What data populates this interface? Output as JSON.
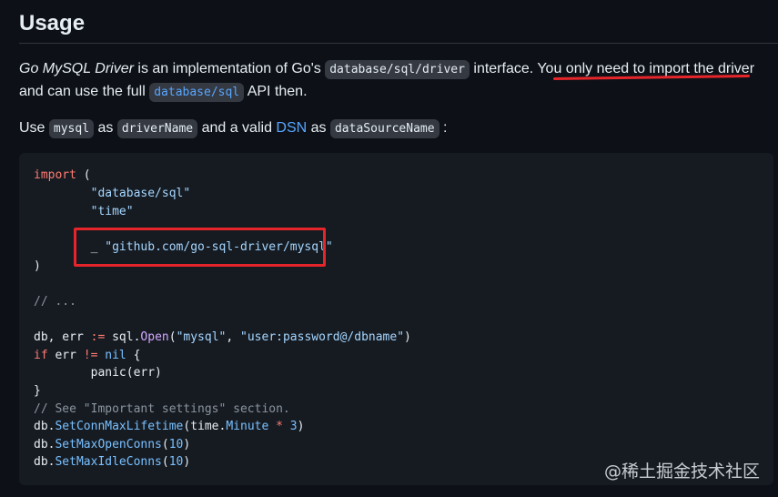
{
  "section": {
    "heading": "Usage"
  },
  "intro": {
    "driver_name": "Go MySQL Driver",
    "text1": " is an implementation of Go's ",
    "code1": "database/sql/driver",
    "text2": " interface. You ",
    "highlight_text": "only need to import the driver",
    "text3": "and can use the full ",
    "code2": "database/sql",
    "text4": " API then."
  },
  "usage_line": {
    "t1": "Use ",
    "code_mysql": "mysql",
    "t2": " as ",
    "code_driver": "driverName",
    "t3": " and a valid ",
    "link_dsn": "DSN",
    "t4": " as ",
    "code_dsn": "dataSourceName",
    "t5": " :"
  },
  "code": {
    "l1_kw": "import",
    "l1_rest": " (",
    "l2": "        \"database/sql\"",
    "l3": "        \"time\"",
    "l5_pre": "        _ ",
    "l5_str": "\"github.com/go-sql-driver/mysql\"",
    "l6": ")",
    "l8": "// ...",
    "l10_a": "db, err ",
    "l10_op": ":=",
    "l10_b": " sql.",
    "l10_fn": "Open",
    "l10_c": "(",
    "l10_s1": "\"mysql\"",
    "l10_d": ", ",
    "l10_s2": "\"user:password@/dbname\"",
    "l10_e": ")",
    "l11_kw": "if",
    "l11_a": " err ",
    "l11_op": "!=",
    "l11_b": " ",
    "l11_nil": "nil",
    "l11_c": " {",
    "l12": "        panic(err)",
    "l13": "}",
    "l14": "// See \"Important settings\" section.",
    "l15_a": "db.",
    "l15_fn": "SetConnMaxLifetime",
    "l15_b": "(time.",
    "l15_c": "Minute",
    "l15_d": " ",
    "l15_op": "*",
    "l15_e": " ",
    "l15_num": "3",
    "l15_f": ")",
    "l16_a": "db.",
    "l16_fn": "SetMaxOpenConns",
    "l16_b": "(",
    "l16_num": "10",
    "l16_c": ")",
    "l17_a": "db.",
    "l17_fn": "SetMaxIdleConns",
    "l17_b": "(",
    "l17_num": "10",
    "l17_c": ")"
  },
  "watermark": "@稀土掘金技术社区",
  "colors": {
    "background": "#0d1117",
    "code_bg": "#161b22",
    "annotation_red": "#e5252a",
    "link": "#58a6ff"
  }
}
